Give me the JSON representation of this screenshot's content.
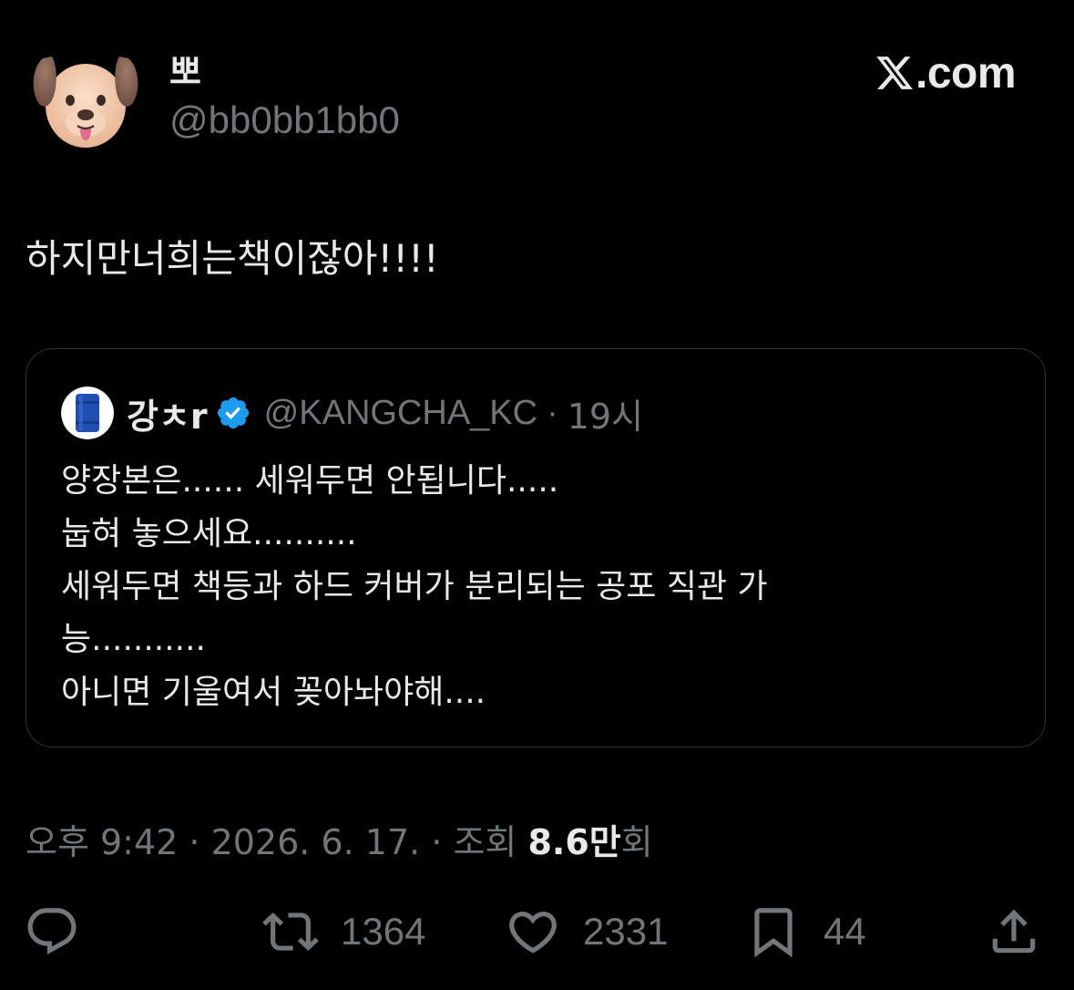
{
  "author": {
    "name": "뽀",
    "handle": "@bb0bb1bb0",
    "avatar_icon": "dog-face-icon"
  },
  "site": {
    "name": ".com",
    "logo_icon": "x-logo-icon"
  },
  "tweet": {
    "text": "하지만너희는책이잖아!!!!"
  },
  "quote": {
    "name": "강ㅊr",
    "handle": "@KANGCHA_KC",
    "separator": "·",
    "time": "19시",
    "lines": [
      "양장본은...... 세워두면 안됩니다.....",
      "눕혀 놓으세요..........",
      "세워두면 책등과 하드 커버가 분리되는 공포 직관 가",
      "능...........",
      "아니면 기울여서 꽂아놔야해...."
    ],
    "avatar_icon": "blue-barrel-icon",
    "verified_icon": "verified-badge-icon"
  },
  "meta": {
    "datetime": "오후 9:42 · 2026. 6. 17. · 조회 ",
    "views_count": "8.6만",
    "views_unit": "회"
  },
  "actions": {
    "reply_icon": "reply-icon",
    "retweet_count": "1364",
    "like_count": "2331",
    "bookmark_count": "44",
    "share_icon": "share-icon"
  },
  "colors": {
    "background": "#000000",
    "text_primary": "#e7e9ea",
    "text_secondary": "#71767b",
    "border": "#2f3336",
    "verified_blue": "#1d9bf0"
  }
}
